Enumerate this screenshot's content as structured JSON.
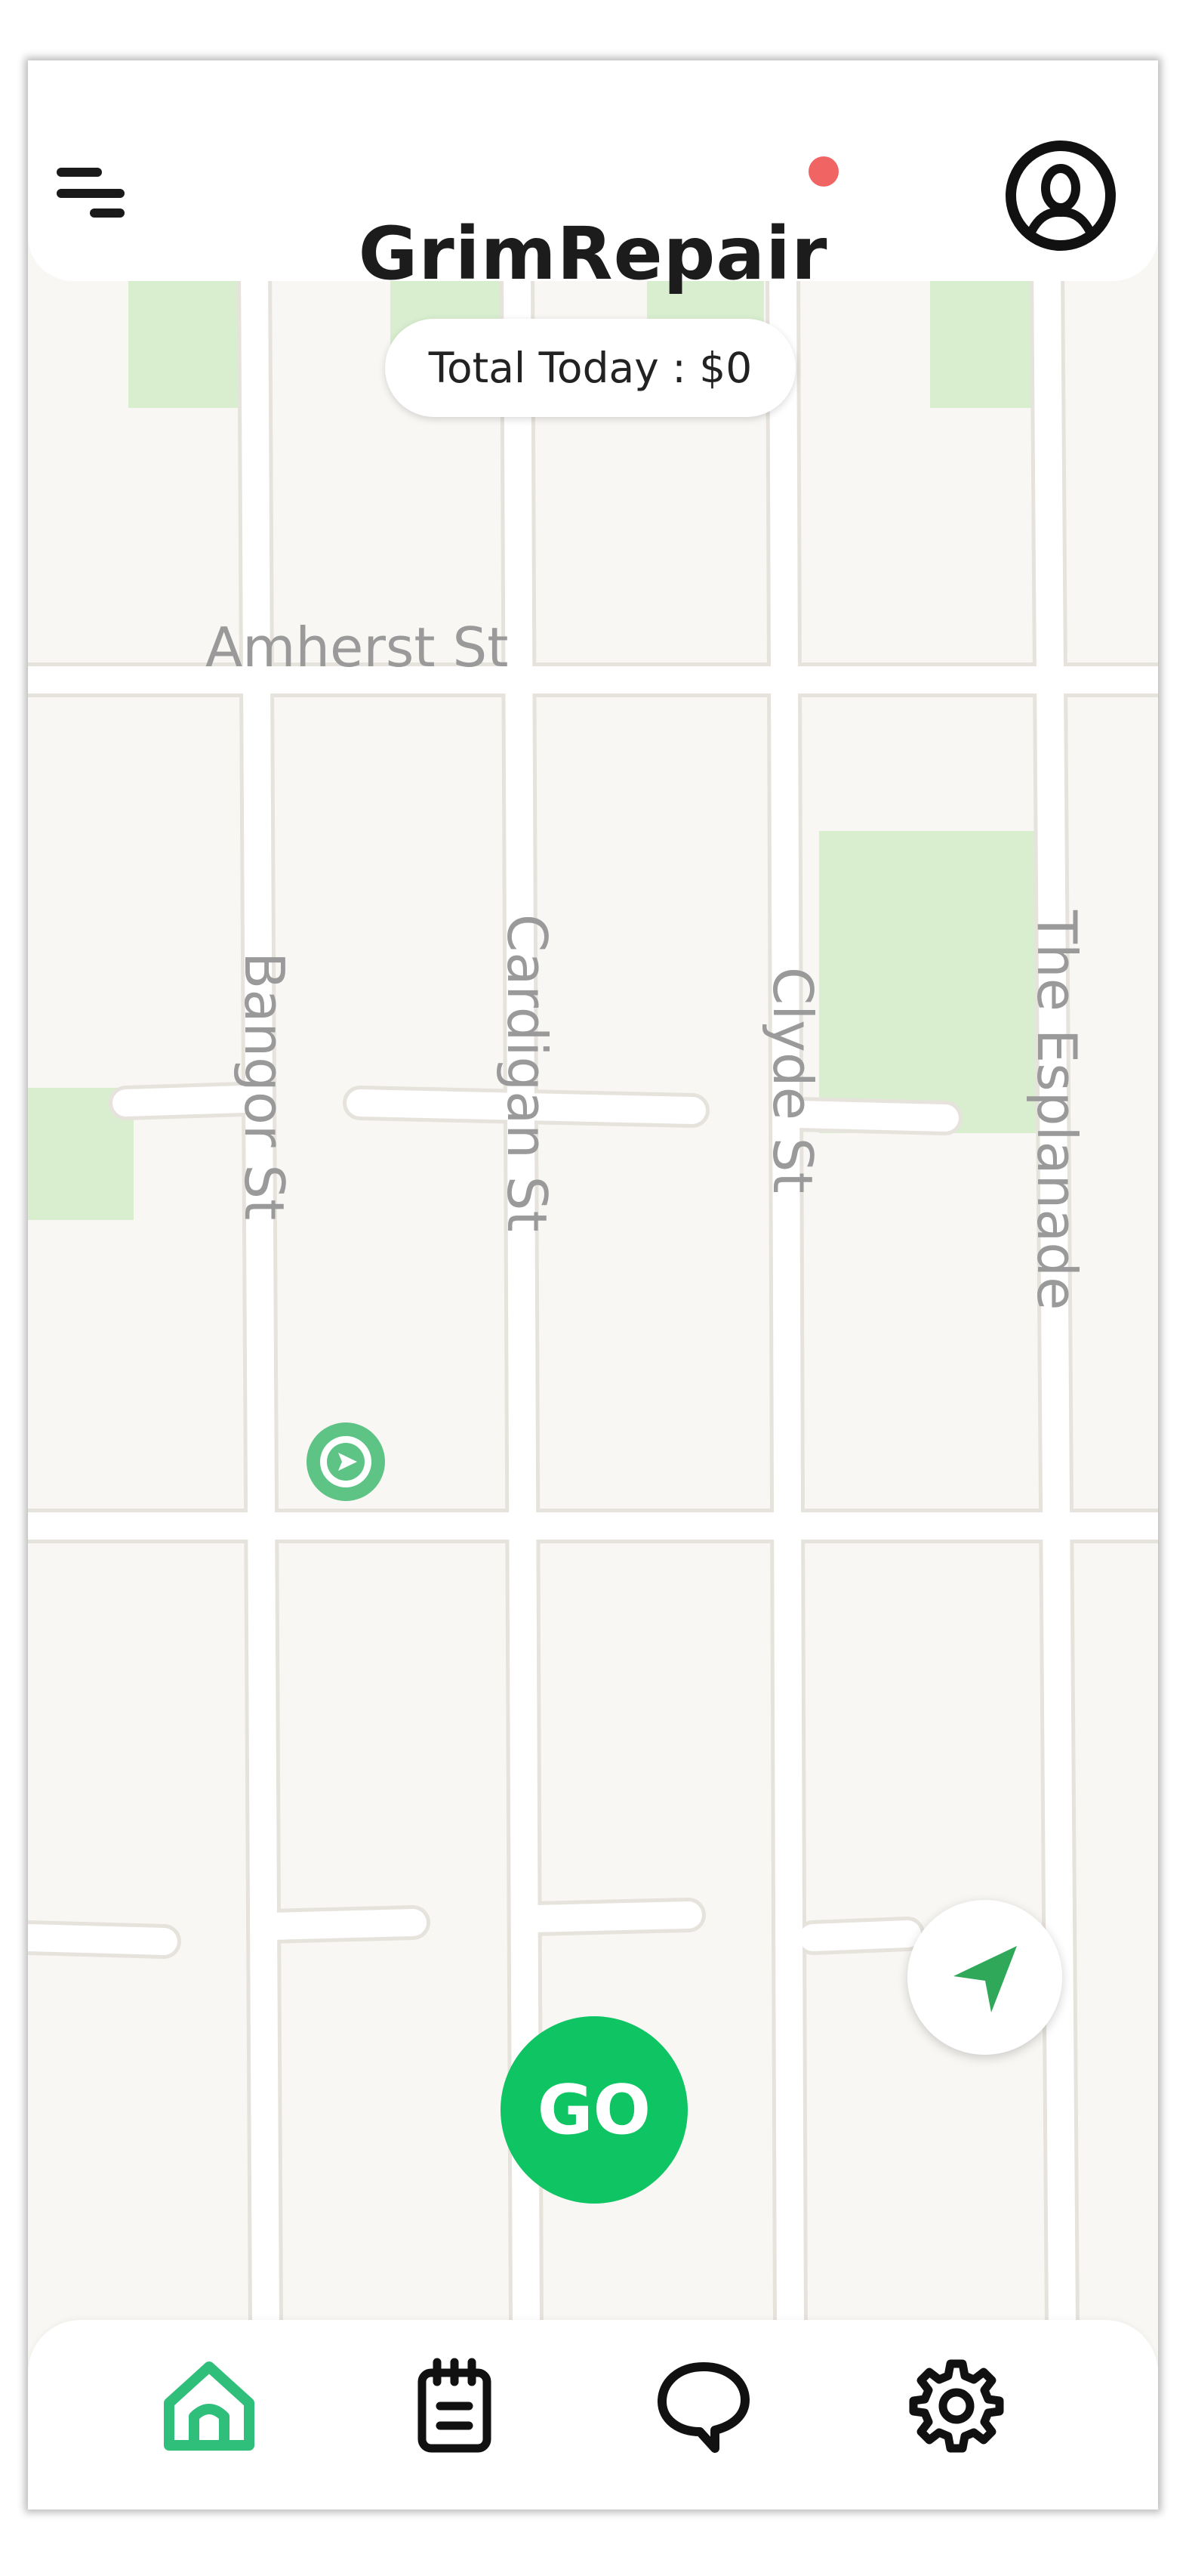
{
  "header": {
    "app_name": "GrimRepair",
    "notification_dot_color": "#f06464",
    "menu_icon": "menu-icon",
    "profile_icon": "user-profile-icon"
  },
  "earnings": {
    "label": "Total Today : $0"
  },
  "map": {
    "streets": [
      "Amherst St",
      "Bangor St",
      "Cardigan St",
      "Clyde St",
      "The Esplanade"
    ],
    "location_marker": "current-location-marker"
  },
  "actions": {
    "go_label": "GO",
    "go_color": "#0ec463",
    "locate_icon": "navigation-arrow-icon"
  },
  "bottom_nav": {
    "items": [
      {
        "name": "home",
        "icon": "home-icon",
        "active": true
      },
      {
        "name": "orders",
        "icon": "notepad-icon",
        "active": false
      },
      {
        "name": "chat",
        "icon": "chat-bubble-icon",
        "active": false
      },
      {
        "name": "settings",
        "icon": "gear-icon",
        "active": false
      }
    ],
    "active_color": "#2fbf7a"
  }
}
